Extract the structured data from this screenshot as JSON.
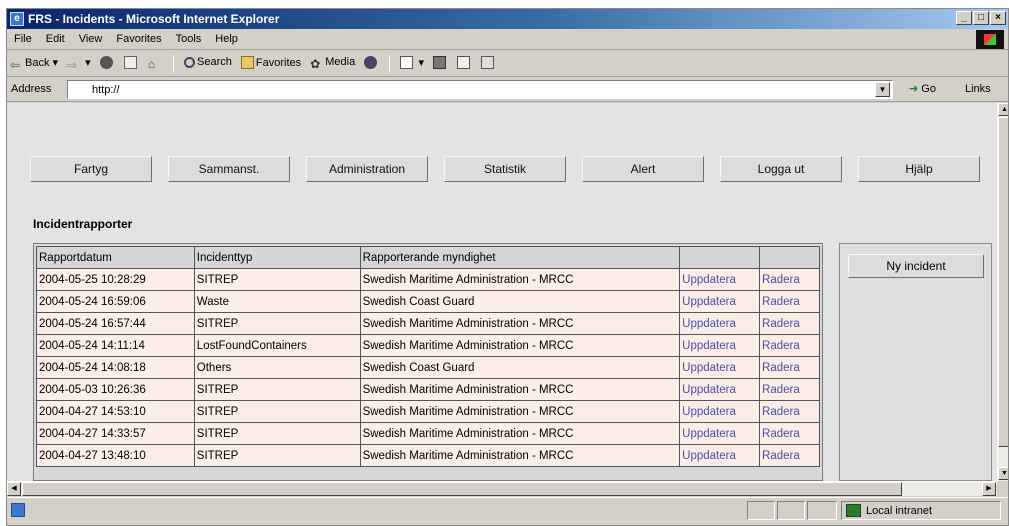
{
  "window": {
    "title": "FRS - Incidents - Microsoft Internet Explorer",
    "controls": {
      "minimize": "_",
      "maximize": "□",
      "close": "×"
    }
  },
  "menu": [
    "File",
    "Edit",
    "View",
    "Favorites",
    "Tools",
    "Help"
  ],
  "toolbar": {
    "back": "Back",
    "search": "Search",
    "favorites": "Favorites",
    "media": "Media"
  },
  "address": {
    "label": "Address",
    "value": "http://",
    "go": "Go",
    "links": "Links"
  },
  "nav": [
    "Fartyg",
    "Sammanst.",
    "Administration",
    "Statistik",
    "Alert",
    "Logga ut",
    "Hjälp"
  ],
  "section_title": "Incidentrapporter",
  "table": {
    "headers": [
      "Rapportdatum",
      "Incidenttyp",
      "Rapporterande myndighet",
      "",
      ""
    ],
    "rows": [
      [
        "2004-05-25 10:28:29",
        "SITREP",
        "Swedish Maritime Administration - MRCC",
        "Uppdatera",
        "Radera"
      ],
      [
        "2004-05-24 16:59:06",
        "Waste",
        "Swedish Coast Guard",
        "Uppdatera",
        "Radera"
      ],
      [
        "2004-05-24 16:57:44",
        "SITREP",
        "Swedish Maritime Administration - MRCC",
        "Uppdatera",
        "Radera"
      ],
      [
        "2004-05-24 14:11:14",
        "LostFoundContainers",
        "Swedish Maritime Administration - MRCC",
        "Uppdatera",
        "Radera"
      ],
      [
        "2004-05-24 14:08:18",
        "Others",
        "Swedish Coast Guard",
        "Uppdatera",
        "Radera"
      ],
      [
        "2004-05-03 10:26:36",
        "SITREP",
        "Swedish Maritime Administration - MRCC",
        "Uppdatera",
        "Radera"
      ],
      [
        "2004-04-27 14:53:10",
        "SITREP",
        "Swedish Maritime Administration - MRCC",
        "Uppdatera",
        "Radera"
      ],
      [
        "2004-04-27 14:33:57",
        "SITREP",
        "Swedish Maritime Administration - MRCC",
        "Uppdatera",
        "Radera"
      ],
      [
        "2004-04-27 13:48:10",
        "SITREP",
        "Swedish Maritime Administration - MRCC",
        "Uppdatera",
        "Radera"
      ]
    ]
  },
  "side": {
    "new_incident": "Ny incident"
  },
  "status": {
    "zone": "Local intranet"
  },
  "colors": {
    "title_gradient_start": "#0a246a",
    "row_background": "#faeee6",
    "link": "#4c4cae",
    "chrome": "#d4d0c8"
  },
  "icons": [
    "ie-icon",
    "back-icon",
    "forward-icon",
    "stop-icon",
    "refresh-icon",
    "home-icon",
    "search-icon",
    "favorites-icon",
    "media-icon",
    "history-icon",
    "mail-icon",
    "print-icon",
    "edit-icon",
    "discuss-icon",
    "go-icon",
    "local-intranet-icon"
  ]
}
